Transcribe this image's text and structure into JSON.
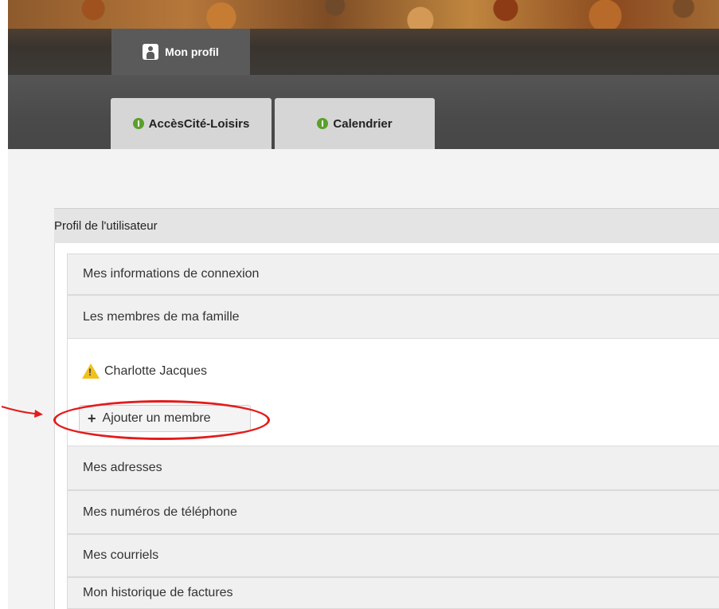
{
  "top_tab": {
    "label": "Mon profil",
    "icon": "profile-icon"
  },
  "nav_tabs": [
    {
      "label": "AccèsCité-Loisirs",
      "icon": "green-info-icon"
    },
    {
      "label": "Calendrier",
      "icon": "green-info-icon"
    }
  ],
  "panel": {
    "title": "Profil de l'utilisateur",
    "sections": [
      {
        "label": "Mes informations de connexion"
      },
      {
        "label": "Les membres de ma famille"
      },
      {
        "label": "Mes adresses"
      },
      {
        "label": "Mes numéros de téléphone"
      },
      {
        "label": "Mes courriels"
      },
      {
        "label": "Mon historique de factures"
      }
    ],
    "family": {
      "member_name": "Charlotte Jacques",
      "member_icon": "warning-icon",
      "add_button": {
        "label": "Ajouter un membre",
        "icon": "plus-icon"
      }
    }
  },
  "annotation": {
    "color": "#e41b1b"
  }
}
